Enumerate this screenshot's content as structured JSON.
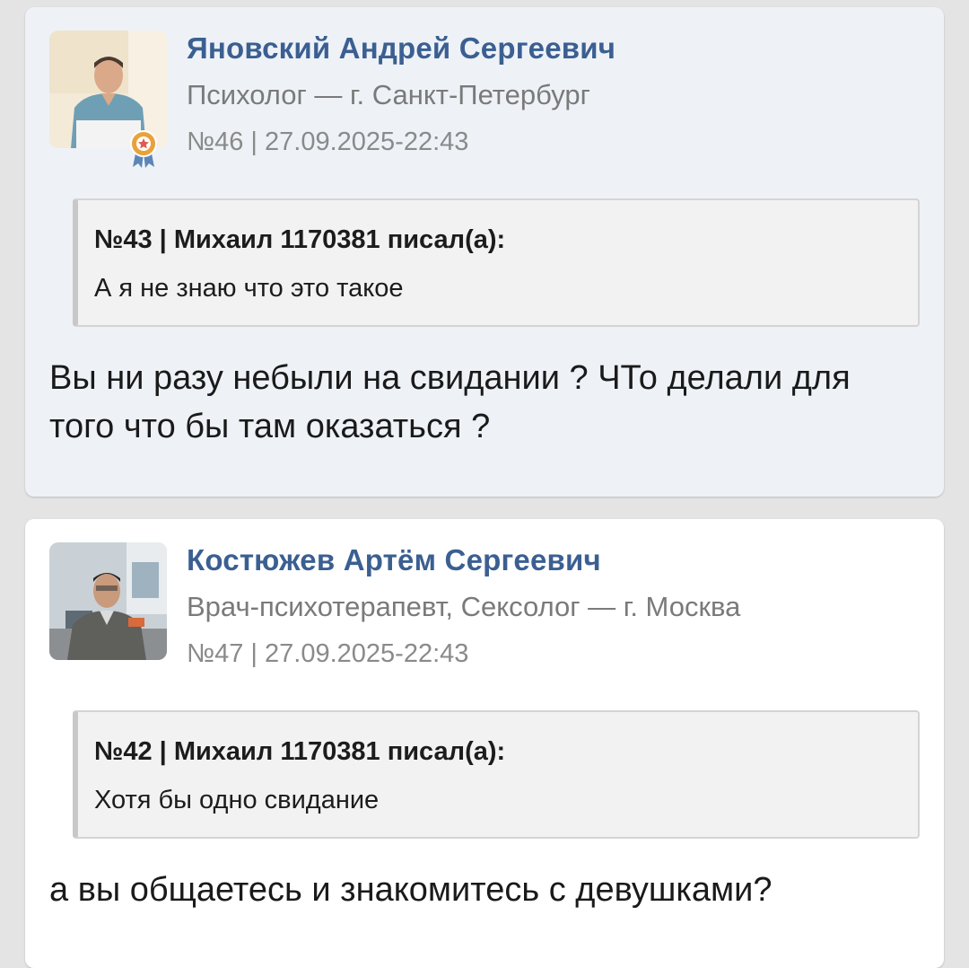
{
  "posts": [
    {
      "author": "Яновский Андрей Сергеевич",
      "role": "Психолог — г. Санкт-Петербург",
      "meta": "№46 | 27.09.2025-22:43",
      "quote": {
        "header": "№43 | Михаил 1170381 писал(а):",
        "text": "А я не знаю что это такое"
      },
      "body": "Вы ни разу небыли на свидании ? ЧТо делали для того что бы там оказаться ?",
      "has_badge": true
    },
    {
      "author": "Костюжев Артём Сергеевич",
      "role": "Врач-психотерапевт, Сексолог — г. Москва",
      "meta": "№47 | 27.09.2025-22:43",
      "quote": {
        "header": "№42 | Михаил 1170381 писал(а):",
        "text": "Хотя бы одно свидание"
      },
      "body": "а вы общаетесь и знакомитесь с девушками?",
      "has_badge": false
    }
  ],
  "colors": {
    "author_link": "#3b5f91",
    "first_post_bg": "#eef2f7",
    "second_post_bg": "#ffffff",
    "page_bg": "#e4e4e4"
  }
}
